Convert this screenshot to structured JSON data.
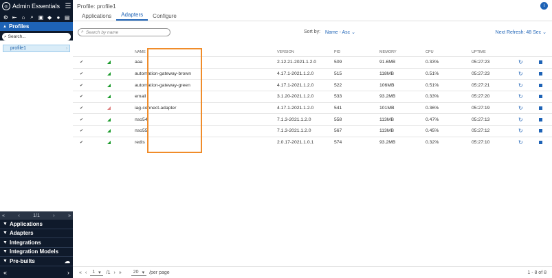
{
  "sidebar": {
    "title": "Admin Essentials",
    "toolbar_icons": [
      "gear-icon",
      "logout-icon",
      "home-icon",
      "search-icon",
      "briefcase-icon",
      "tag-icon",
      "user-icon",
      "document-icon"
    ],
    "profiles_label": "Profiles",
    "search_placeholder": "Search...",
    "profile_item": "profile1",
    "pager": {
      "first": "«",
      "prev": "‹",
      "page": "1/1",
      "next": "›",
      "last": "»"
    },
    "groups": [
      "Applications",
      "Adapters",
      "Integrations",
      "Integration Models",
      "Pre-builts"
    ],
    "collapse_left": "«",
    "collapse_right": "›"
  },
  "header": {
    "title": "Profile: profile1",
    "info": "i",
    "tabs": [
      "Applications",
      "Adapters",
      "Configure"
    ]
  },
  "controls": {
    "search_placeholder": "Search by name",
    "sort_label": "Sort by:",
    "sort_value": "Name - Asc",
    "refresh": "Next Refresh: 48 Sec"
  },
  "table": {
    "columns": [
      "NAME",
      "VERSION",
      "PID",
      "MEMORY",
      "CPU",
      "UPTIME"
    ],
    "rows": [
      {
        "name": "aaa",
        "version": "2.12.21-2021.1.2.0",
        "pid": "509",
        "memory": "91.6MB",
        "cpu": "0.33%",
        "uptime": "05:27:23",
        "state": "ok"
      },
      {
        "name": "automation-gateway-brown",
        "version": "4.17.1-2021.1.2.0",
        "pid": "515",
        "memory": "118MB",
        "cpu": "0.51%",
        "uptime": "05:27:23",
        "state": "ok"
      },
      {
        "name": "automation-gateway-green",
        "version": "4.17.1-2021.1.2.0",
        "pid": "522",
        "memory": "106MB",
        "cpu": "0.51%",
        "uptime": "05:27:21",
        "state": "ok"
      },
      {
        "name": "email",
        "version": "3.1.20-2021.1.2.0",
        "pid": "533",
        "memory": "93.2MB",
        "cpu": "0.33%",
        "uptime": "05:27:20",
        "state": "ok"
      },
      {
        "name": "iag-connect-adapter",
        "version": "4.17.1-2021.1.2.0",
        "pid": "541",
        "memory": "101MB",
        "cpu": "0.36%",
        "uptime": "05:27:19",
        "state": "warn"
      },
      {
        "name": "nso54",
        "version": "7.1.3-2021.1.2.0",
        "pid": "558",
        "memory": "113MB",
        "cpu": "0.47%",
        "uptime": "05:27:13",
        "state": "ok"
      },
      {
        "name": "nso55",
        "version": "7.1.3-2021.1.2.0",
        "pid": "567",
        "memory": "113MB",
        "cpu": "0.45%",
        "uptime": "05:27:12",
        "state": "ok"
      },
      {
        "name": "redis",
        "version": "2.0.17-2021.1.0.1",
        "pid": "574",
        "memory": "93.2MB",
        "cpu": "0.32%",
        "uptime": "05:27:10",
        "state": "ok"
      }
    ]
  },
  "footer": {
    "first": "«",
    "prev": "‹",
    "page": "1",
    "of": "/1",
    "next": "›",
    "last": "»",
    "per_page_value": "20",
    "per_page_label": "/per page",
    "count": "1 - 8 of 8"
  },
  "colors": {
    "accent": "#1e63b6",
    "sidebar_bg": "#0f1a2b",
    "highlight": "#f08c2a",
    "status_ok": "#1a9a2a",
    "status_warn": "#e08080"
  }
}
